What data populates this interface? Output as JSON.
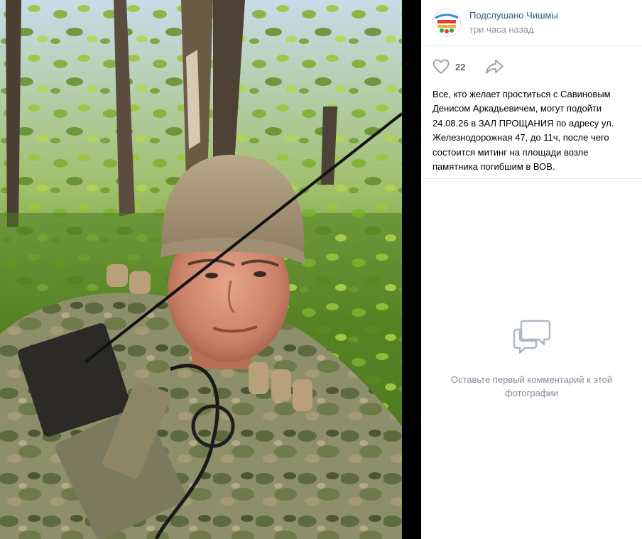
{
  "post": {
    "author": "Подслушано Чишмы",
    "time": "три часа назад",
    "likes": "22",
    "text": "Все, кто желает проститься с Савиновым Денисом Аркадьевичем, могут подойти 24.08.26 в ЗАЛ ПРОЩАНИЯ по адресу ул. Железнодорожная 47, до 11ч, после чего состоится митинг на площади возле памятника погибшим в ВОВ."
  },
  "comments": {
    "empty_text": "Оставьте первый комментарий к этой фотографии"
  },
  "icons": {
    "like": "heart-icon",
    "share": "share-arrow-icon",
    "comments": "comment-bubbles-icon"
  },
  "colors": {
    "link": "#2a5885",
    "muted": "#939393",
    "icon": "#99a2ad"
  }
}
